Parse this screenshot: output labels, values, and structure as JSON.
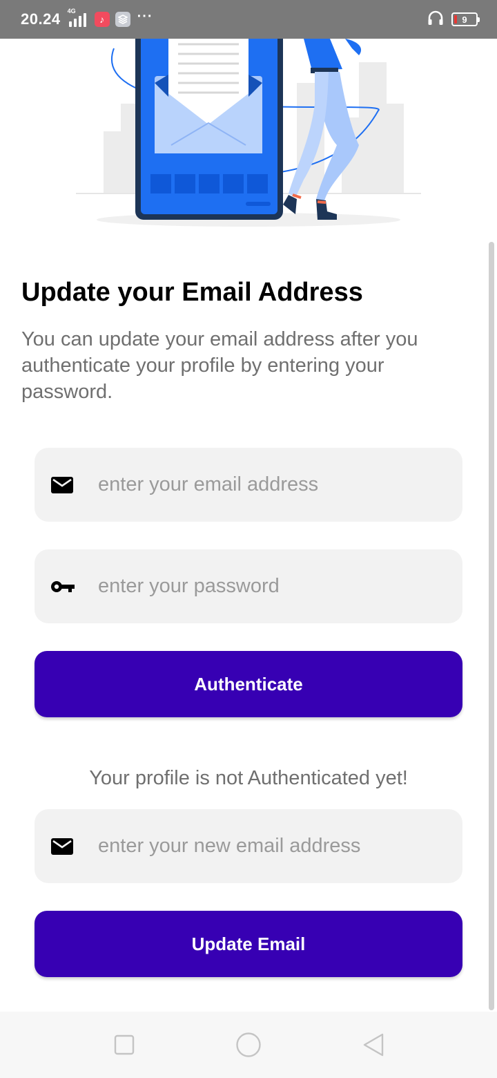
{
  "status_bar": {
    "time": "20.24",
    "network": "4G",
    "battery_level": "9",
    "more": "···"
  },
  "content": {
    "title": "Update your Email Address",
    "subtitle": "You can update your email address after you authenticate your profile by entering your password."
  },
  "form": {
    "email_placeholder": "enter your email address",
    "password_placeholder": "enter your password",
    "authenticate_label": "Authenticate",
    "auth_status": "Your profile is not Authenticated yet!",
    "new_email_placeholder": "enter your new email address",
    "update_label": "Update Email"
  },
  "colors": {
    "primary_button": "#3700b3",
    "field_background": "#f2f2f2",
    "illustration_blue": "#1e6ff2"
  },
  "icons": {
    "email": "mail-icon",
    "password": "key-icon",
    "nav": [
      "recent-apps-icon",
      "home-icon",
      "back-icon"
    ]
  }
}
